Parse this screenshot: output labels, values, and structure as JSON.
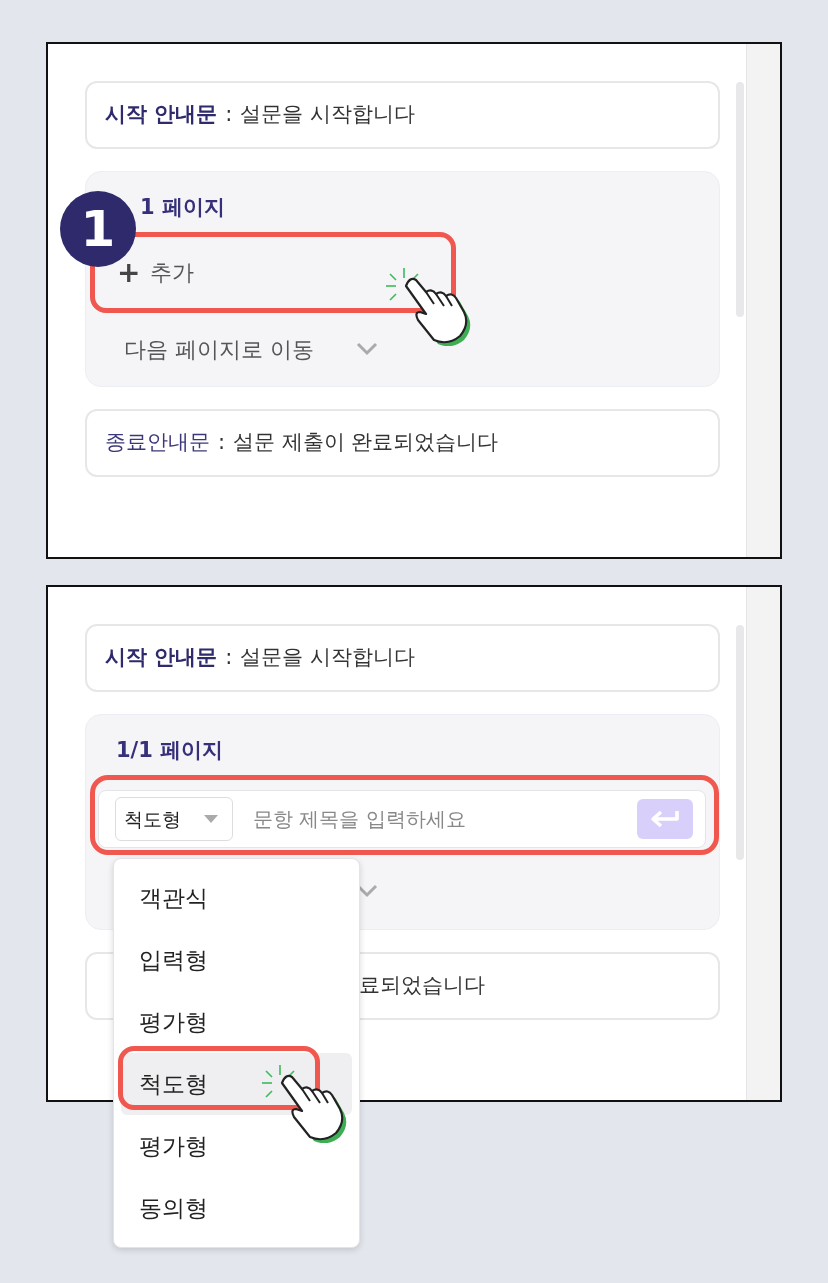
{
  "panels": [
    {
      "start_notice": {
        "label": "시작 안내문",
        "separator": ":",
        "value": "설문을 시작합니다"
      },
      "step_badge": "1",
      "page": {
        "title": "1 페이지",
        "add_button": {
          "icon": "+",
          "label": "추가",
          "highlighted": true
        },
        "next_action": {
          "label": "다음 페이지로 이동"
        }
      },
      "end_notice": {
        "label": "종료안내문",
        "separator": ":",
        "value": "설문 제출이 완료되었습니다"
      }
    },
    {
      "start_notice": {
        "label": "시작 안내문",
        "separator": ":",
        "value": "설문을 시작합니다"
      },
      "page": {
        "title": "1/1 페이지",
        "question_input": {
          "type_select": "척도형",
          "placeholder": "문항 제목을 입력하세요",
          "highlighted": true
        }
      },
      "end_notice": {
        "value": "료되었습니다"
      },
      "type_menu": [
        {
          "label": "객관식",
          "selected": false
        },
        {
          "label": "입력형",
          "selected": false
        },
        {
          "label": "평가형",
          "selected": false
        },
        {
          "label": "척도형",
          "selected": true
        },
        {
          "label": "평가형",
          "selected": false
        },
        {
          "label": "동의형",
          "selected": false
        }
      ]
    }
  ]
}
